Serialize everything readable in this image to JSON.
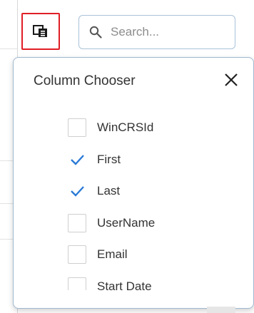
{
  "toolbar": {
    "column_chooser_icon": "column-chooser-icon",
    "search": {
      "placeholder": "Search...",
      "value": "",
      "icon": "search-icon"
    }
  },
  "column_chooser": {
    "title": "Column Chooser",
    "close_icon": "close-icon",
    "columns": [
      {
        "label": "WinCRSId",
        "checked": false
      },
      {
        "label": "First",
        "checked": true
      },
      {
        "label": "Last",
        "checked": true
      },
      {
        "label": "UserName",
        "checked": false
      },
      {
        "label": "Email",
        "checked": false
      },
      {
        "label": "Start Date",
        "checked": false
      }
    ]
  },
  "colors": {
    "highlight_border": "#e01e26",
    "checkmark": "#2b7bd6",
    "panel_border": "#9fb8cf"
  }
}
